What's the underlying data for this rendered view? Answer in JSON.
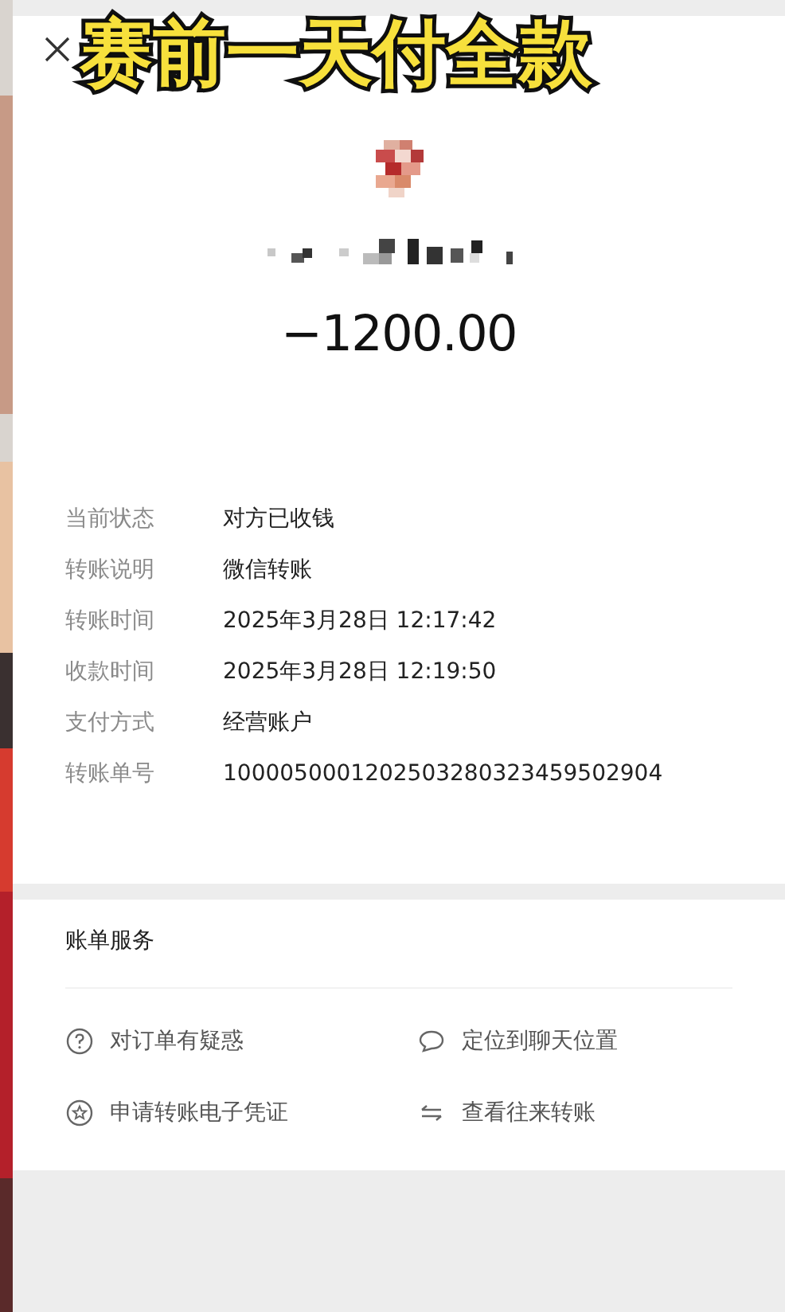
{
  "caption": "赛前一天付全款",
  "amount": "−1200.00",
  "details": [
    {
      "label": "当前状态",
      "value": "对方已收钱"
    },
    {
      "label": "转账说明",
      "value": "微信转账"
    },
    {
      "label": "转账时间",
      "value": "2025年3月28日 12:17:42"
    },
    {
      "label": "收款时间",
      "value": "2025年3月28日 12:19:50"
    },
    {
      "label": "支付方式",
      "value": "经营账户"
    },
    {
      "label": "转账单号",
      "value": "1000050001202503280323459502904"
    }
  ],
  "services": {
    "title": "账单服务",
    "items": [
      {
        "kind": "question",
        "label": "对订单有疑惑"
      },
      {
        "kind": "chat",
        "label": "定位到聊天位置"
      },
      {
        "kind": "certificate",
        "label": "申请转账电子凭证"
      },
      {
        "kind": "exchange",
        "label": "查看往来转账"
      }
    ]
  }
}
